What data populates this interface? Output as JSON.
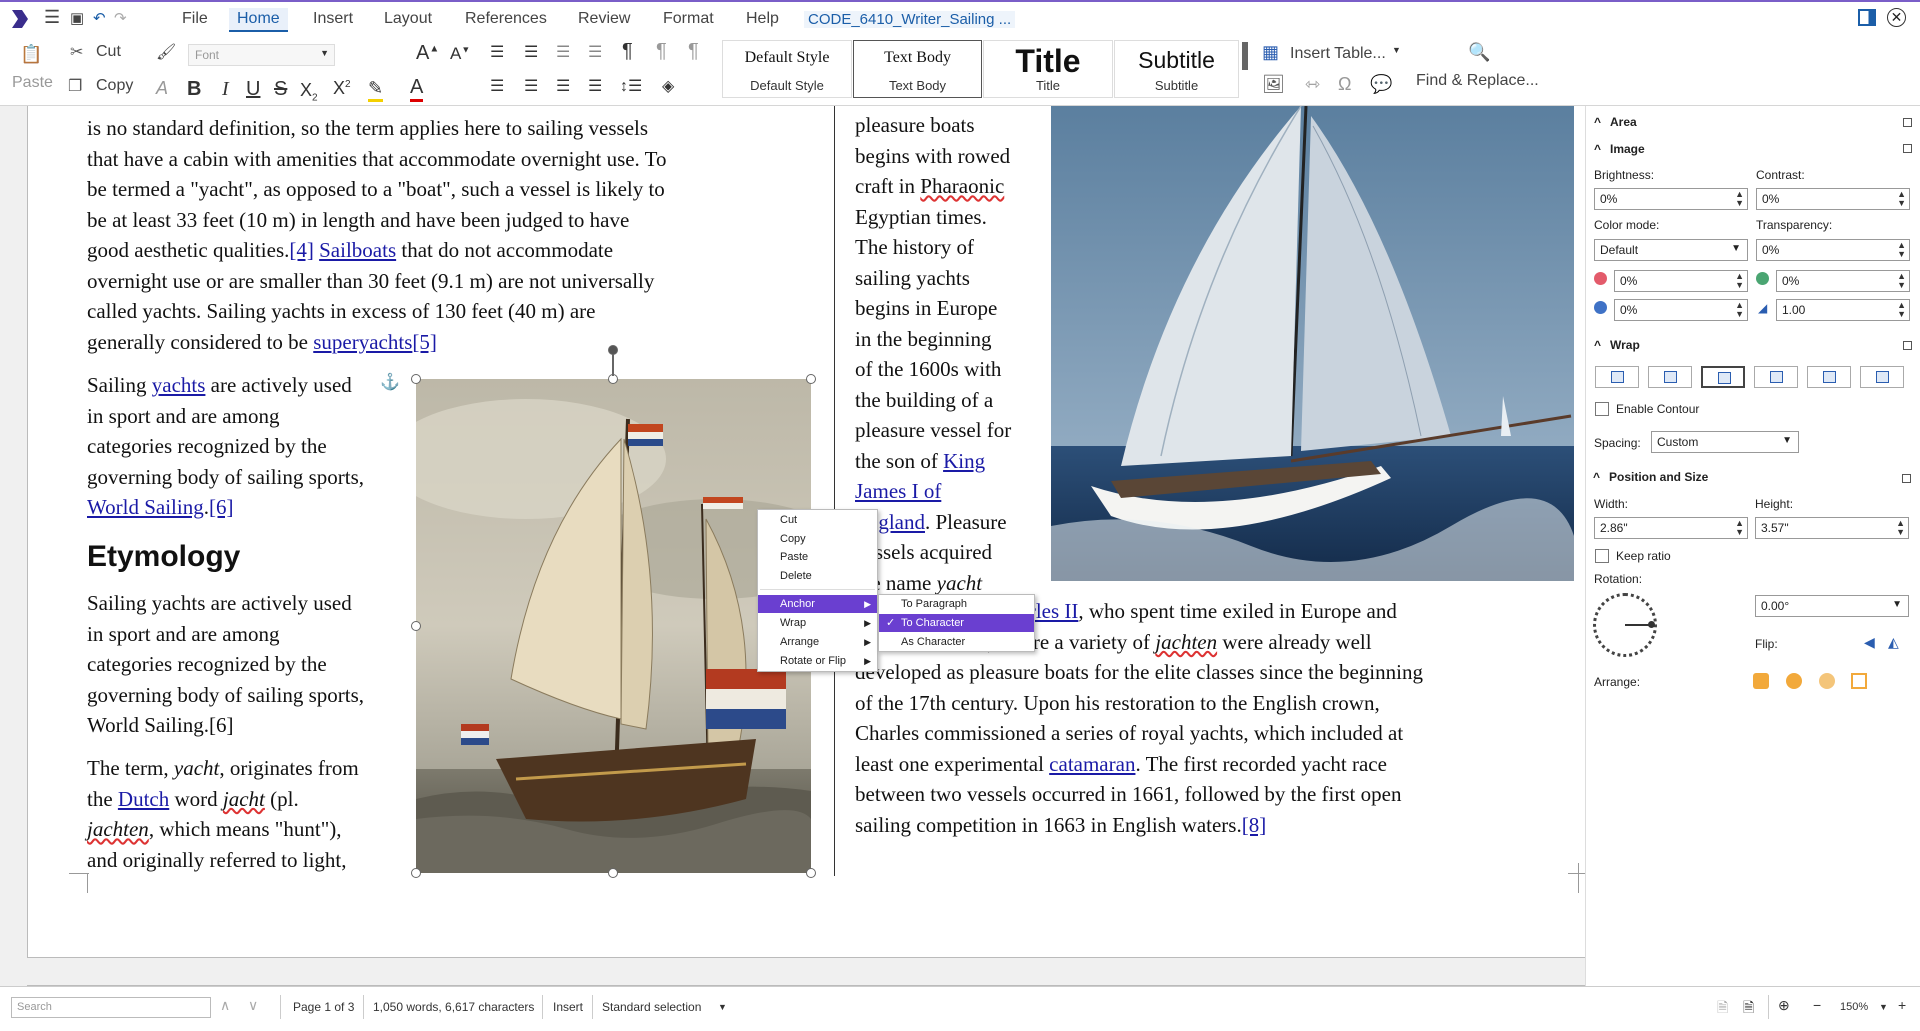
{
  "menubar": {
    "items": [
      "File",
      "Home",
      "Insert",
      "Layout",
      "References",
      "Review",
      "Format",
      "Help"
    ],
    "active": "Home",
    "document_title": "CODE_6410_Writer_Sailing ..."
  },
  "toolbar": {
    "paste": "Paste",
    "cut": "Cut",
    "copy": "Copy",
    "font_placeholder": "Font",
    "styles": [
      {
        "preview": "Default Style",
        "label": "Default Style"
      },
      {
        "preview": "Text Body",
        "label": "Text Body"
      },
      {
        "preview": "Title",
        "label": "Title"
      },
      {
        "preview": "Subtitle",
        "label": "Subtitle"
      }
    ],
    "insert_table": "Insert Table...",
    "find_replace": "Find & Replace..."
  },
  "left_column": {
    "para1_lines": [
      "is no standard definition, so the term applies here to sailing vessels",
      "that have a cabin with amenities that accommodate overnight use. To",
      "be termed a \"yacht\", as opposed to a \"boat\", such a vessel is likely to",
      "be at least 33 feet (10 m) in length and have been judged to have"
    ],
    "para1_l5_a": "good aesthetic qualities.",
    "ref4": "[4]",
    "sailboats": "Sailboats",
    "para1_l5_b": " that do not accommodate",
    "para1_l6": "overnight use or are smaller than 30 feet (9.1 m) are not universally",
    "para1_l7": "called yachts. Sailing yachts in excess of 130 feet (40 m) are",
    "para1_l8_a": "generally considered to be ",
    "superyachts": "superyachts",
    "ref5": "[5]",
    "para2_a": "Sailing ",
    "yachts_link": "yachts",
    "para2_b": " are actively used",
    "para2_lines": [
      "in sport and are among",
      "categories recognized by the",
      "governing body of sailing sports,"
    ],
    "world_sailing": "World Sailing",
    "ref6": "[6]",
    "heading": "Etymology",
    "para3_lines": [
      "Sailing yachts are actively used",
      "in sport and are among",
      "categories recognized by the",
      "governing body of sailing sports,",
      "World Sailing.[6]"
    ],
    "para4_a": "The term, ",
    "yacht_i": "yacht",
    "para4_b": ", originates from",
    "para4_c": "the ",
    "dutch": "Dutch",
    "para4_d": " word ",
    "jacht_i": "jacht",
    "para4_e": " (pl.",
    "jachten_i": "jachten",
    "para4_f": ", which means \"hunt\"),",
    "para4_g": "and originally referred to light,"
  },
  "right_column": {
    "lines": [
      "pleasure boats",
      "begins with rowed",
      "craft in "
    ],
    "pharaonic": "Pharaonic",
    "lines2": [
      "Egyptian times.",
      "The history of",
      "sailing yachts",
      "begins in Europe",
      "in the beginning",
      "of the 1600s with",
      "the building of a",
      "pleasure vessel for",
      "the son of "
    ],
    "king": "King",
    "james": "James I of",
    "england": "England",
    "after_england": ". Pleasure",
    "vessels": "vessels acquired",
    "name_yacht_a": "the name ",
    "name_yacht_i": "yacht",
    "charles": "Charles II",
    "charles_after": ", who spent time exiled in Europe and",
    "neth_a": "the Netherlands, where a variety of ",
    "jachten": "jachten",
    "neth_b": " were already well",
    "wide_lines": [
      "developed as pleasure boats for the elite classes since the beginning",
      "of the 17th century. Upon his restoration to the English crown,",
      "Charles commissioned a series of royal yachts, which included at"
    ],
    "cat_a": "least one experimental ",
    "catamaran": "catamaran",
    "cat_b": ". The first recorded yacht race",
    "race_line": "between two vessels occurred in 1661, followed by the first open",
    "last_a": "sailing competition in 1663 in English waters.",
    "ref8": "[8]"
  },
  "context_menu": {
    "items": [
      "Cut",
      "Copy",
      "Paste",
      "Delete",
      "Anchor",
      "Wrap",
      "Arrange",
      "Rotate or Flip"
    ],
    "highlighted": "Anchor",
    "submenu": [
      "To Paragraph",
      "To Character",
      "As Character"
    ],
    "submenu_checked": "To Character",
    "checkmark": "✓"
  },
  "sidebar": {
    "area": "Area",
    "image": "Image",
    "brightness_label": "Brightness:",
    "brightness": "0%",
    "contrast_label": "Contrast:",
    "contrast": "0%",
    "color_mode_label": "Color mode:",
    "color_mode": "Default",
    "transparency_label": "Transparency:",
    "transparency": "0%",
    "red": "0%",
    "green": "0%",
    "blue": "0%",
    "gamma": "1.00",
    "wrap": "Wrap",
    "enable_contour": "Enable Contour",
    "spacing_label": "Spacing:",
    "spacing": "Custom",
    "position_size": "Position and Size",
    "width_label": "Width:",
    "width": "2.86\"",
    "height_label": "Height:",
    "height": "3.57\"",
    "keep_ratio": "Keep ratio",
    "rotation_label": "Rotation:",
    "rotation": "0.00°",
    "flip_label": "Flip:",
    "arrange_label": "Arrange:"
  },
  "statusbar": {
    "search_placeholder": "Search",
    "page": "Page 1 of 3",
    "words": "1,050 words, 6,617 characters",
    "mode": "Insert",
    "selection": "Standard selection",
    "zoom": "150%"
  },
  "colors": {
    "accent": "#6a3fd0",
    "link": "#1a1aa6",
    "brand_blue": "#1b5ea8"
  }
}
